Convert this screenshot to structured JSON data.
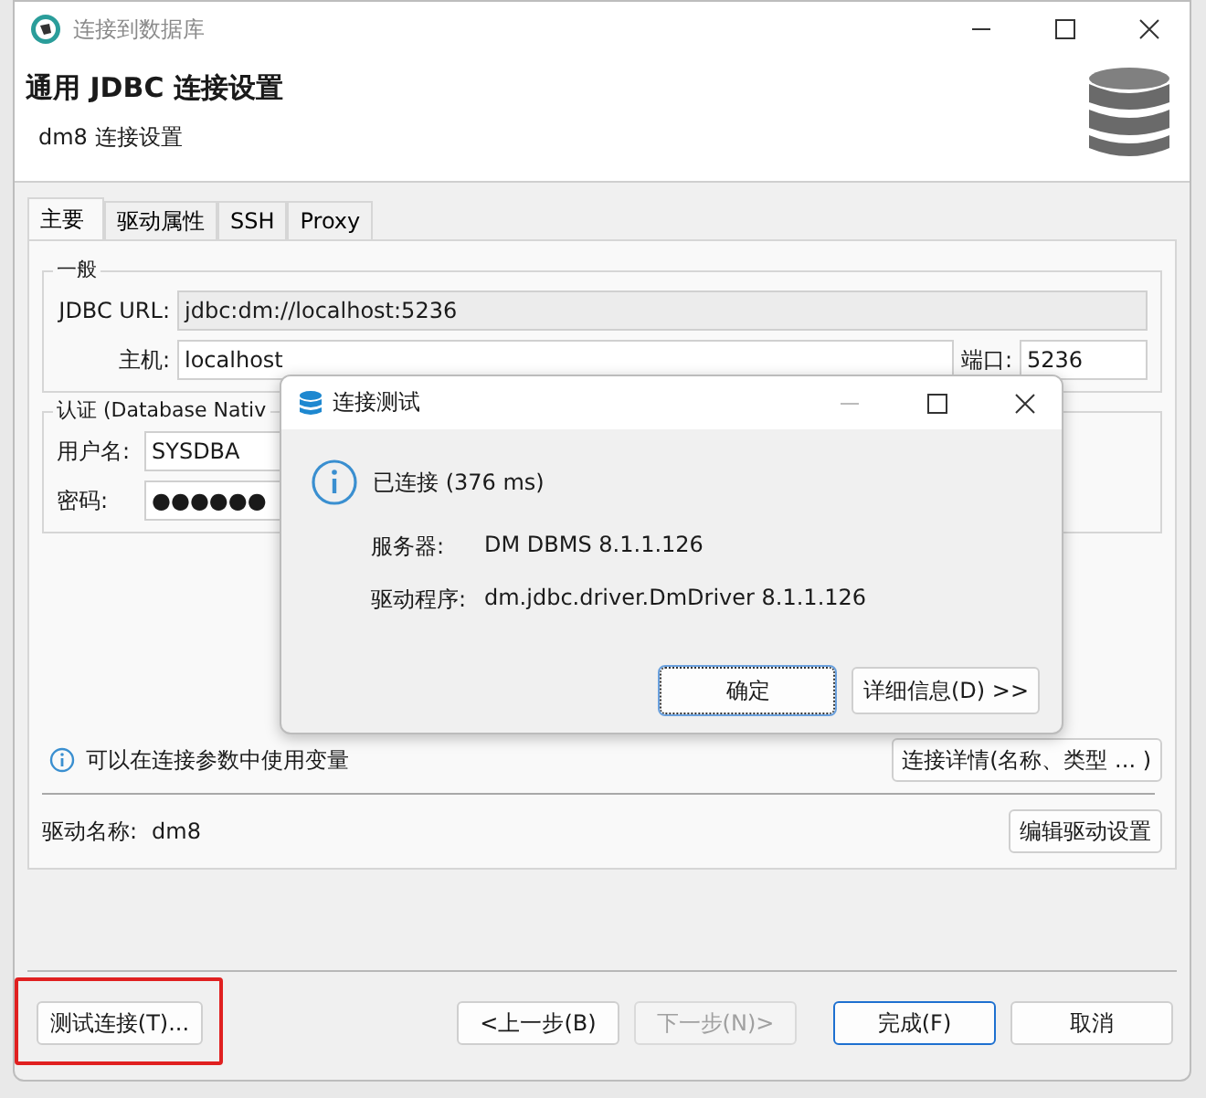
{
  "window": {
    "title": "连接到数据库"
  },
  "header": {
    "title": "通用 JDBC 连接设置",
    "subtitle": "dm8 连接设置"
  },
  "tabs": [
    {
      "label": "主要",
      "selected": true
    },
    {
      "label": "驱动属性",
      "selected": false
    },
    {
      "label": "SSH",
      "selected": false
    },
    {
      "label": "Proxy",
      "selected": false
    }
  ],
  "general": {
    "legend": "一般",
    "url_label": "JDBC URL:",
    "url": "jdbc:dm://localhost:5236",
    "host_label": "主机:",
    "host": "localhost",
    "port_label": "端口:",
    "port": "5236"
  },
  "auth": {
    "legend": "认证 (Database Nativ",
    "user_label": "用户名:",
    "user": "SYSDBA",
    "password_label": "密码:",
    "password": "●●●●●●"
  },
  "info": {
    "text": "可以在连接参数中使用变量",
    "button": "连接详情(名称、类型 ... )"
  },
  "driver": {
    "label": "驱动名称:",
    "value": "dm8",
    "button": "编辑驱动设置"
  },
  "test_button": {
    "label": "测试连接(T)...",
    "highlighted": true
  },
  "nav_buttons": [
    {
      "label": "<上一步(B)",
      "disabled": false,
      "default": false
    },
    {
      "label": "下一步(N)>",
      "disabled": true,
      "default": false
    },
    {
      "label": "完成(F)",
      "disabled": false,
      "default": true
    },
    {
      "label": "取消",
      "disabled": false,
      "default": false
    }
  ],
  "dialog": {
    "title": "连接测试",
    "status": "已连接 (376 ms)",
    "rows": [
      {
        "label": "服务器:",
        "value": "DM DBMS 8.1.1.126"
      },
      {
        "label": "驱动程序:",
        "value": "dm.jdbc.driver.DmDriver 8.1.1.126"
      }
    ],
    "buttons": [
      {
        "label": "确定",
        "default": true
      },
      {
        "label": "详细信息(D) >>",
        "default": false
      }
    ]
  }
}
